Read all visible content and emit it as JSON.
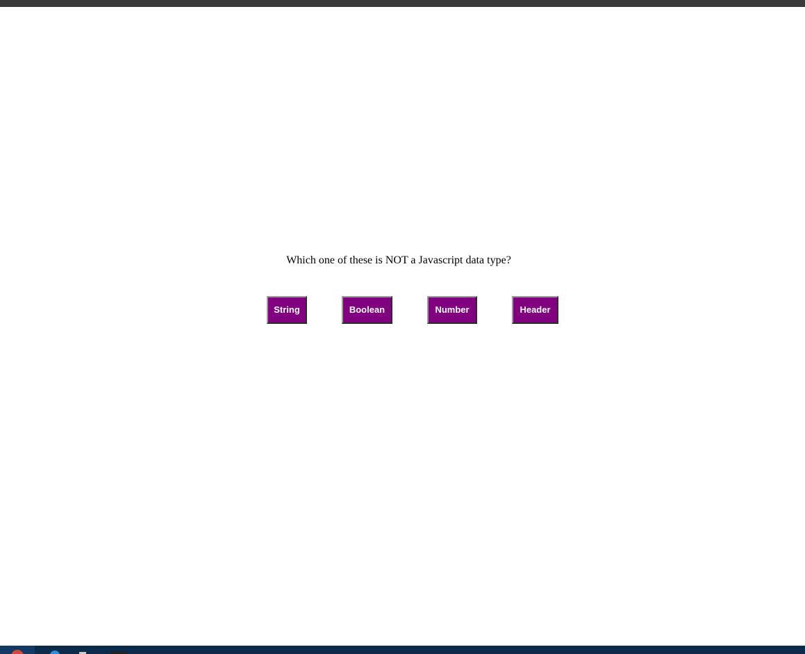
{
  "quiz": {
    "question": "Which one of these is NOT a Javascript data type?",
    "answers": [
      {
        "label": "String"
      },
      {
        "label": "Boolean"
      },
      {
        "label": "Number"
      },
      {
        "label": "Header"
      }
    ]
  },
  "theme": {
    "button_bg": "#800080",
    "button_text": "#ffffff",
    "top_bar": "#3a3a3a",
    "taskbar": "#0c2a4a"
  },
  "taskbar": {
    "icons": [
      "start-icon",
      "edge-browser-icon",
      "file-explorer-icon",
      "terminal-icon"
    ]
  }
}
